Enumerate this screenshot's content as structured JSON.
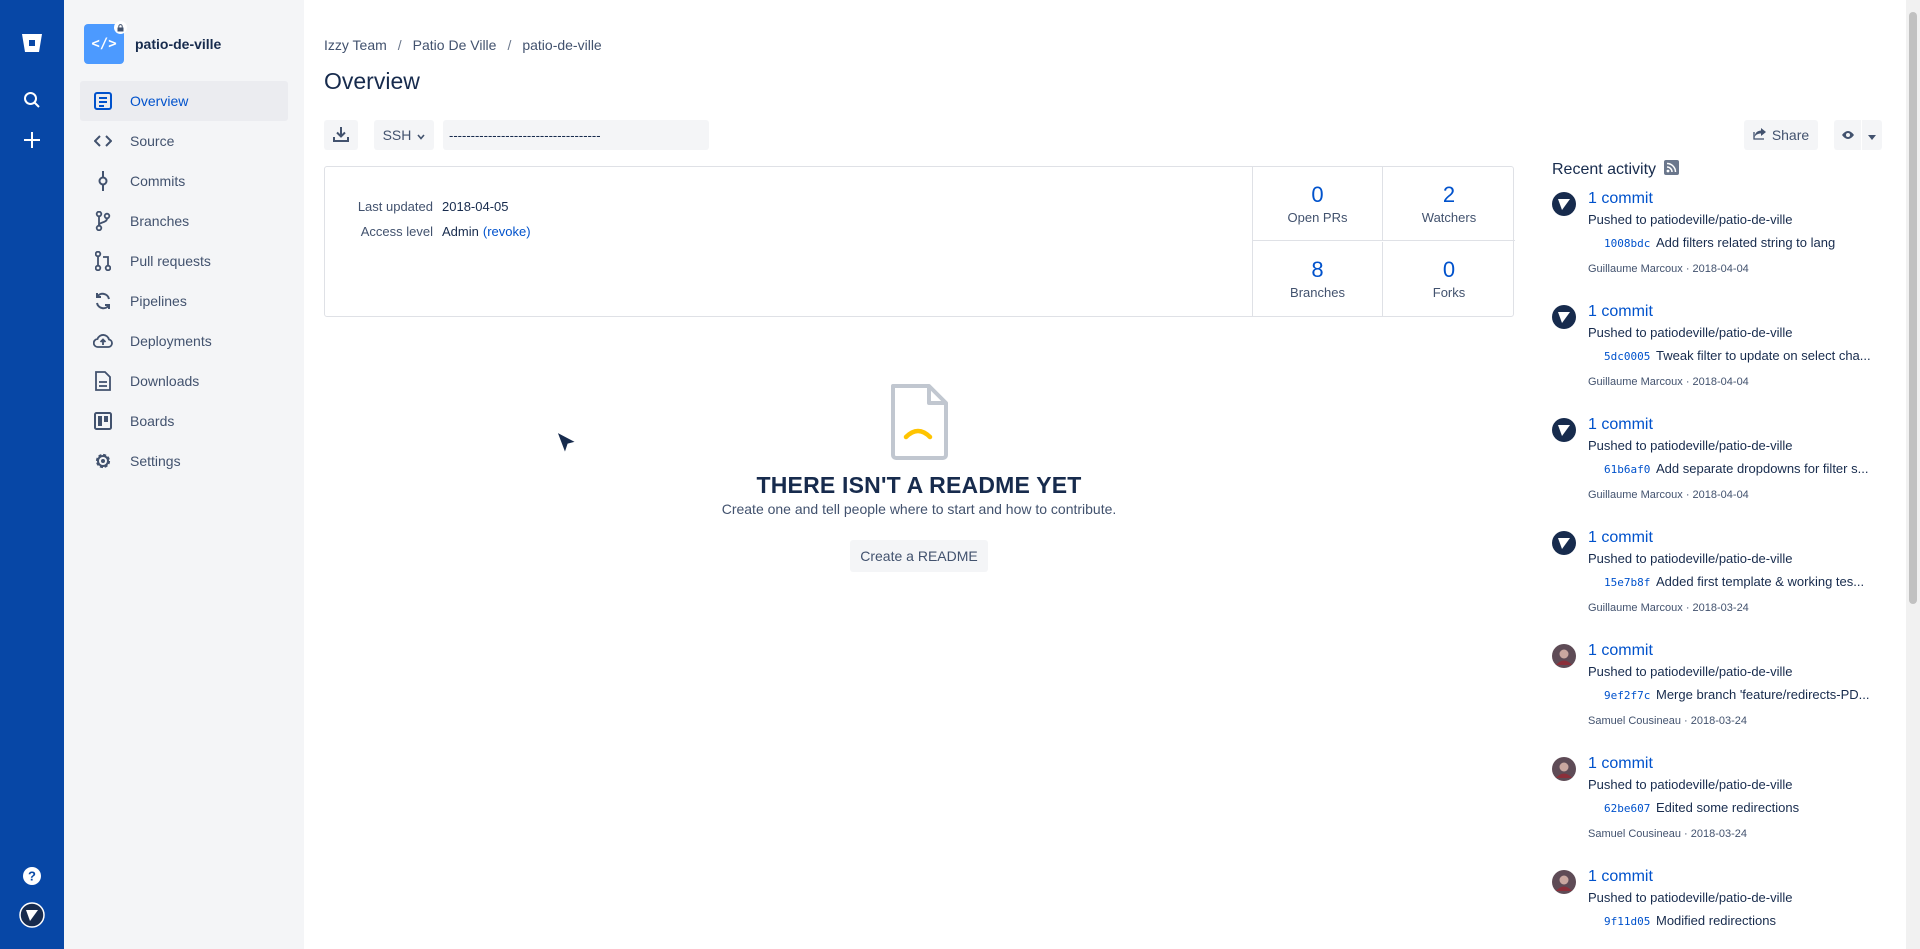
{
  "rail": {
    "logo_icon": "bitbucket-icon",
    "search_icon": "search-icon",
    "create_icon": "plus-icon",
    "help_icon": "help-icon",
    "user_icon": "user-avatar-icon"
  },
  "sidebar": {
    "repo_name": "patio-de-ville",
    "items": [
      {
        "label": "Overview",
        "icon": "overview-icon",
        "active": true
      },
      {
        "label": "Source",
        "icon": "source-code-icon"
      },
      {
        "label": "Commits",
        "icon": "commit-icon"
      },
      {
        "label": "Branches",
        "icon": "branch-icon"
      },
      {
        "label": "Pull requests",
        "icon": "pull-request-icon"
      },
      {
        "label": "Pipelines",
        "icon": "pipelines-icon"
      },
      {
        "label": "Deployments",
        "icon": "deployments-icon"
      },
      {
        "label": "Downloads",
        "icon": "downloads-icon"
      },
      {
        "label": "Boards",
        "icon": "boards-icon"
      },
      {
        "label": "Settings",
        "icon": "settings-icon"
      }
    ]
  },
  "breadcrumb": [
    "Izzy Team",
    "Patio De Ville",
    "patio-de-ville"
  ],
  "page_title": "Overview",
  "toolbar": {
    "protocol": "SSH",
    "clone_value": "-----------------------------------",
    "share_label": "Share"
  },
  "info": {
    "last_updated_label": "Last updated",
    "last_updated_value": "2018-04-05",
    "access_label": "Access level",
    "access_value": "Admin",
    "revoke_label": "(revoke)"
  },
  "stats": [
    {
      "num": "0",
      "cap": "Open PRs"
    },
    {
      "num": "2",
      "cap": "Watchers"
    },
    {
      "num": "8",
      "cap": "Branches"
    },
    {
      "num": "0",
      "cap": "Forks"
    }
  ],
  "readme": {
    "heading": "THERE ISN'T A README YET",
    "sub": "Create one and tell people where to start and how to contribute.",
    "button": "Create a README"
  },
  "activity": {
    "title": "Recent activity",
    "items": [
      {
        "commits": "1 commit",
        "pushed": "Pushed to patiodeville/patio-de-ville",
        "hash": "1008bdc",
        "msg": "Add filters related string to lang",
        "meta": "Guillaume Marcoux · 2018-04-04",
        "avatar": "gm"
      },
      {
        "commits": "1 commit",
        "pushed": "Pushed to patiodeville/patio-de-ville",
        "hash": "5dc0005",
        "msg": "Tweak filter to update on select cha...",
        "meta": "Guillaume Marcoux · 2018-04-04",
        "avatar": "gm"
      },
      {
        "commits": "1 commit",
        "pushed": "Pushed to patiodeville/patio-de-ville",
        "hash": "61b6af0",
        "msg": "Add separate dropdowns for filter s...",
        "meta": "Guillaume Marcoux · 2018-04-04",
        "avatar": "gm"
      },
      {
        "commits": "1 commit",
        "pushed": "Pushed to patiodeville/patio-de-ville",
        "hash": "15e7b8f",
        "msg": "Added first template & working tes...",
        "meta": "Guillaume Marcoux · 2018-03-24",
        "avatar": "gm"
      },
      {
        "commits": "1 commit",
        "pushed": "Pushed to patiodeville/patio-de-ville",
        "hash": "9ef2f7c",
        "msg": "Merge branch 'feature/redirects-PD...",
        "meta": "Samuel Cousineau · 2018-03-24",
        "avatar": "sc"
      },
      {
        "commits": "1 commit",
        "pushed": "Pushed to patiodeville/patio-de-ville",
        "hash": "62be607",
        "msg": "Edited some redirections",
        "meta": "Samuel Cousineau · 2018-03-24",
        "avatar": "sc"
      },
      {
        "commits": "1 commit",
        "pushed": "Pushed to patiodeville/patio-de-ville",
        "hash": "9f11d05",
        "msg": "Modified redirections",
        "meta": "",
        "avatar": "sc"
      }
    ]
  },
  "colors": {
    "rail": "#0747a6",
    "link": "#0052cc",
    "sidebar": "#f4f5f7"
  }
}
